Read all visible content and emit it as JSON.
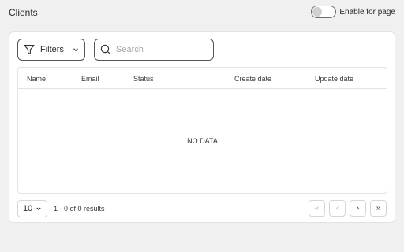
{
  "header": {
    "title": "Clients",
    "toggle_label": "Enable for page",
    "toggle_on": false
  },
  "toolbar": {
    "filters_label": "Filters",
    "search_placeholder": "Search",
    "search_value": ""
  },
  "table": {
    "columns": [
      "Name",
      "Email",
      "Status",
      "Create date",
      "Update date"
    ],
    "rows": [],
    "empty_text": "NO DATA"
  },
  "footer": {
    "page_size": "10",
    "results_text": "1 - 0 of 0 results",
    "pager": {
      "first": "«",
      "prev": "‹",
      "next": "›",
      "last": "»"
    }
  },
  "icons": {
    "filter": "filter-icon",
    "search": "search-icon",
    "chevron": "chevron-down-icon"
  }
}
